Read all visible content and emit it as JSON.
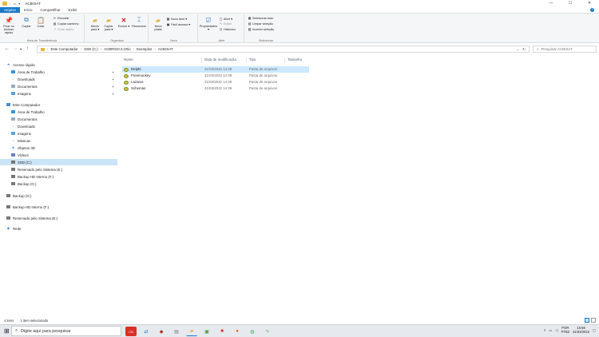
{
  "window": {
    "title": "ACBrSAT",
    "controls": {
      "minimize": "—",
      "maximize": "☐",
      "close": "✕"
    }
  },
  "tabs": [
    {
      "label": "Arquivo",
      "active": true
    },
    {
      "label": "Início",
      "active": false
    },
    {
      "label": "Compartilhar",
      "active": false
    },
    {
      "label": "Exibir",
      "active": false
    }
  ],
  "ribbon": {
    "clipboard": {
      "label": "Área de Transferência",
      "pin": "Fixar no Acesso rápido",
      "copy": "Copiar",
      "paste": "Colar",
      "cut": "Recortar",
      "copy_path": "Copiar caminho",
      "paste_shortcut": "Colar atalho"
    },
    "organize": {
      "label": "Organizar",
      "move_to": "Mover para ▾",
      "copy_to": "Copiar para ▾",
      "delete": "Excluir ▾",
      "rename": "Renomear"
    },
    "new": {
      "label": "Novo",
      "new_folder": "Nova pasta",
      "new_item": "Novo item ▾",
      "easy_access": "Fácil acesso ▾"
    },
    "open": {
      "label": "Abrir",
      "properties": "Propriedades ▾",
      "open": "Abrir ▾",
      "edit": "Editar",
      "history": "Histórico"
    },
    "select": {
      "label": "Selecionar",
      "select_all": "Selecionar tudo",
      "select_none": "Limpar seleção",
      "invert": "Inverter seleção"
    }
  },
  "address": {
    "segments": [
      "Este Computador",
      "SSD (C:)",
      "ACBR010.3.1Rio",
      "Exemplos",
      "ACBrSAT"
    ],
    "search_placeholder": "Pesquisar ACBrSAT"
  },
  "nav": {
    "quick_access": "Acesso rápido",
    "quick_items": [
      "Área de Trabalho",
      "Downloads",
      "Documentos",
      "Imagens"
    ],
    "this_pc": "Este Computador",
    "pc_items": [
      "Área de Trabalho",
      "Documentos",
      "Downloads",
      "Imagens",
      "Músicas",
      "Objetos 3D",
      "Vídeos",
      "SSD (C:)",
      "Reservado pelo Sistema (E:)",
      "Backup HD Interno (F:)",
      "Backup (G:)"
    ],
    "drives": [
      "Backup (G:)",
      "Backup HD Interno (F:)",
      "Reservado pelo Sistema (E:)"
    ],
    "network": "Rede"
  },
  "filelist": {
    "columns": {
      "name": "Nome",
      "date": "Data de modificação",
      "type": "Tipo",
      "size": "Tamanho"
    },
    "rows": [
      {
        "name": "Delphi",
        "date": "31/03/2022 14:38",
        "type": "Pasta de arquivos",
        "selected": true
      },
      {
        "name": "Freemonkey",
        "date": "31/03/2022 14:38",
        "type": "Pasta de arquivos",
        "selected": false
      },
      {
        "name": "Lazarus",
        "date": "31/03/2022 14:38",
        "type": "Pasta de arquivos",
        "selected": false
      },
      {
        "name": "Schemas",
        "date": "31/03/2022 14:38",
        "type": "Pasta de arquivos",
        "selected": false
      }
    ]
  },
  "status": {
    "count": "4 itens",
    "selected": "1 item selecionado"
  },
  "taskbar": {
    "search_placeholder": "Digite aqui para pesquisar",
    "lang": "POR",
    "lang_sub": "PTB2",
    "time": "15:56",
    "date": "31/03/2022"
  },
  "colors": {
    "accent": "#1979ca",
    "selection": "#cce8ff",
    "folder": "#e2b53e"
  }
}
